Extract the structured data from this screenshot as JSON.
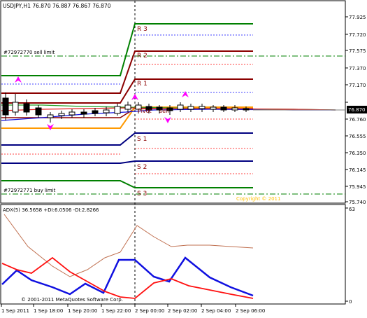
{
  "main_chart": {
    "header": "USDJPY,H1  76.870 76.887 76.867 76.870",
    "price_labels": [
      "77.925",
      "77.720",
      "77.575",
      "77.370",
      "77.170",
      "76.965",
      "76.760",
      "76.555",
      "76.350",
      "76.145",
      "75.945",
      "75.740"
    ],
    "current_price": "76.870",
    "pivot_labels": {
      "r3": "R 3",
      "r2": "R 2",
      "r1": "R 1",
      "pivot": "Pivot",
      "s1": "S 1",
      "s2": "S 2",
      "s3": "S 3"
    },
    "order_labels": {
      "sell": "#72972770 sell limit",
      "buy": "#72972771 buy limit",
      "sell_short": "sell"
    },
    "copyright": "Copyright © 2011"
  },
  "indicator": {
    "header": "ADX(5) 36.5658 +DI:6.0506 -DI:2.8266",
    "scale_top": "63",
    "scale_bottom": "0",
    "footer": "© 2001-2011 MetaQuotes Software Corp."
  },
  "time_axis": [
    "1 Sep 2011",
    "1 Sep 18:00",
    "1 Sep 20:00",
    "1 Sep 22:00",
    "2 Sep 00:00",
    "2 Sep 02:00",
    "2 Sep 04:00",
    "2 Sep 06:00"
  ],
  "colors": {
    "resistance": "#8b0000",
    "r3": "#008000",
    "support": "#000080",
    "level_dotted_blue": "#4040ff",
    "level_dotted_red": "#ff4040",
    "orange": "#ff9900",
    "order_line": "#008000",
    "adx_line": "#c07050",
    "plus_di": "#1010e0",
    "minus_di": "#ff1010",
    "copyright": "#ffc000",
    "fractal": "#ff00ff"
  }
}
